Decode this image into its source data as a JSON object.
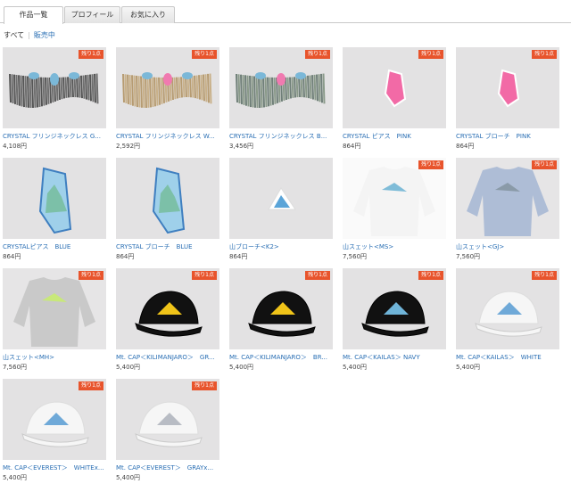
{
  "tabs": [
    {
      "label": "作品一覧",
      "active": true
    },
    {
      "label": "プロフィール",
      "active": false
    },
    {
      "label": "お気に入り",
      "active": false
    }
  ],
  "filter": {
    "all": "すべて",
    "on_sale": "販売中"
  },
  "badge_label": "残り1点",
  "items": [
    {
      "title": "CRYSTAL フリンジネックレス G...",
      "price": "4,108円",
      "badge": true,
      "icon": "fringe-necklace-gray"
    },
    {
      "title": "CRYSTAL フリンジネックレス W...",
      "price": "2,592円",
      "badge": true,
      "icon": "fringe-necklace-white"
    },
    {
      "title": "CRYSTAL フリンジネックレス B...",
      "price": "3,456円",
      "badge": true,
      "icon": "fringe-necklace-blue"
    },
    {
      "title": "CRYSTAL ピアス　PINK",
      "price": "864円",
      "badge": true,
      "icon": "crystal-pierce-pink"
    },
    {
      "title": "CRYSTAL ブローチ　PINK",
      "price": "864円",
      "badge": true,
      "icon": "crystal-brooch-pink"
    },
    {
      "title": "CRYSTALピアス　BLUE",
      "price": "864円",
      "badge": false,
      "icon": "crystal-pierce-blue"
    },
    {
      "title": "CRYSTAL ブローチ　BLUE",
      "price": "864円",
      "badge": false,
      "icon": "crystal-brooch-blue"
    },
    {
      "title": "山ブローチ<K2>",
      "price": "864円",
      "badge": false,
      "icon": "mountain-brooch"
    },
    {
      "title": "山スェット<MS>",
      "price": "7,560円",
      "badge": true,
      "icon": "sweat-white"
    },
    {
      "title": "山スェット<GJ>",
      "price": "7,560円",
      "badge": true,
      "icon": "sweat-blue"
    },
    {
      "title": "山スェット<MH>",
      "price": "7,560円",
      "badge": true,
      "icon": "sweat-gray"
    },
    {
      "title": "Mt. CAP＜KILIMANJARO＞　GR...",
      "price": "5,400円",
      "badge": true,
      "icon": "cap-black-yellow"
    },
    {
      "title": "Mt. CAP＜KILIMANJARO＞　BR...",
      "price": "5,400円",
      "badge": true,
      "icon": "cap-black-yellow-2"
    },
    {
      "title": "Mt. CAP＜KAILAS＞ NAVY",
      "price": "5,400円",
      "badge": true,
      "icon": "cap-navy"
    },
    {
      "title": "Mt. CAP＜KAILAS＞　WHITE",
      "price": "5,400円",
      "badge": true,
      "icon": "cap-white"
    },
    {
      "title": "Mt. CAP＜EVEREST＞　WHITEx...",
      "price": "5,400円",
      "badge": true,
      "icon": "cap-white-blue"
    },
    {
      "title": "Mt. CAP＜EVEREST＞　GRAYx...",
      "price": "5,400円",
      "badge": true,
      "icon": "cap-white-gray"
    }
  ],
  "colors": {
    "link": "#2a6fb4",
    "badge": "#e8542c",
    "thumb_bg": "#e3e2e3"
  }
}
